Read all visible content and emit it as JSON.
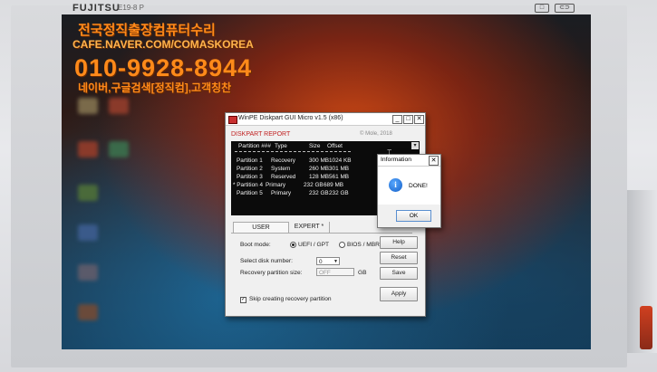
{
  "watermark": {
    "line1": "전국정직출장컴퓨터수리",
    "line2": "CAFE.NAVER.COM/COMASKOREA",
    "line3": "010-9928-8944",
    "line4": "네이버,구글검색[정직컴],고객칭찬"
  },
  "monitor": {
    "brand": "FUJITSU",
    "model": "E19-8 P",
    "button_labels": [
      "□",
      "⊂⊃"
    ]
  },
  "window": {
    "title": "WinPE Diskpart GUI Micro v1.5 (x86)",
    "controls": {
      "minimize": "_",
      "maximize": "□",
      "close": "✕"
    },
    "section_label": "DISKPART REPORT",
    "copyright": "© Mole, 2018",
    "table": {
      "headers": [
        "Partition ###",
        "Type",
        "Size",
        "Offset"
      ],
      "rows": [
        {
          "partition": "Partition 1",
          "type": "Recovery",
          "size": "300 MB",
          "offset": "1024 KB"
        },
        {
          "partition": "Partition 2",
          "type": "System",
          "size": "260 MB",
          "offset": "301 MB"
        },
        {
          "partition": "Partition 3",
          "type": "Reserved",
          "size": "128 MB",
          "offset": "561 MB"
        },
        {
          "partition": "* Partition 4",
          "type": "Primary",
          "size": "232 GB",
          "offset": "689 MB"
        },
        {
          "partition": "Partition 5",
          "type": "Primary",
          "size": "232 GB",
          "offset": "232 GB"
        }
      ]
    },
    "tabs": [
      "USER",
      "EXPERT *"
    ],
    "boot_mode_label": "Boot mode:",
    "boot_options": [
      "UEFI / GPT",
      "BIOS / MBR"
    ],
    "boot_selected": "UEFI / GPT",
    "disk_label": "Select disk number:",
    "disk_value": "0",
    "recovery_label": "Recovery partition size:",
    "recovery_placeholder": "OFF",
    "recovery_unit": "GB",
    "skip_label": "Skip creating recovery partition",
    "skip_checked": true,
    "buttons": {
      "help": "Help",
      "reset": "Reset",
      "save": "Save",
      "apply": "Apply"
    }
  },
  "dialog": {
    "title": "Information",
    "close": "✕",
    "message": "DONE!",
    "ok": "OK",
    "icon": "info-icon"
  },
  "colors": {
    "report_label": "#c02020",
    "watermark": "#ff8a1a",
    "terminal_bg": "#0b0b0b"
  }
}
